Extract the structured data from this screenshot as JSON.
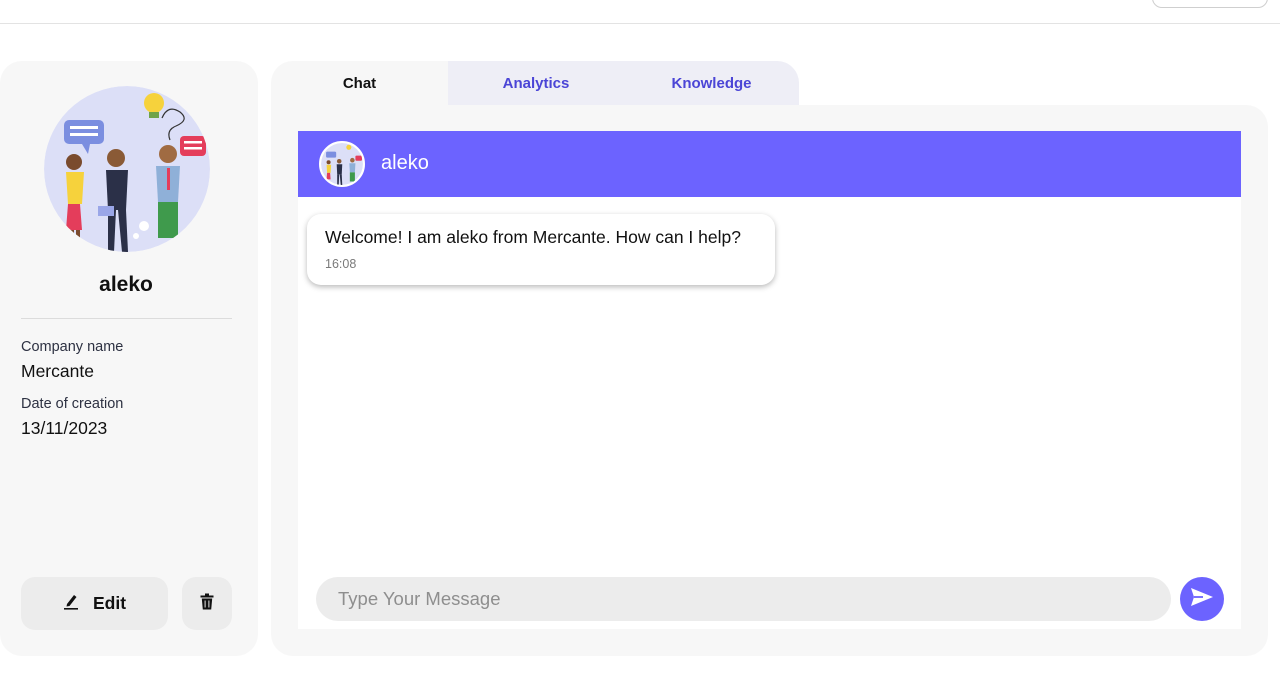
{
  "profile": {
    "name": "aleko",
    "company_label": "Company name",
    "company_value": "Mercante",
    "date_label": "Date of creation",
    "date_value": "13/11/2023",
    "edit_label": "Edit",
    "avatar_icon": "team-illustration-avatar",
    "edit_icon": "pencil-icon",
    "delete_icon": "trash-icon"
  },
  "tabs": [
    {
      "label": "Chat",
      "active": true
    },
    {
      "label": "Analytics",
      "active": false
    },
    {
      "label": "Knowledge",
      "active": false
    }
  ],
  "chat": {
    "bot_name": "aleko",
    "messages": [
      {
        "text": "Welcome! I am aleko from Mercante. How can I help?",
        "time": "16:08"
      }
    ],
    "input_placeholder": "Type Your Message",
    "send_icon": "send-icon"
  },
  "colors": {
    "accent": "#6c63ff",
    "tab_text": "#4b45d6",
    "card_background": "#f7f7f7"
  }
}
